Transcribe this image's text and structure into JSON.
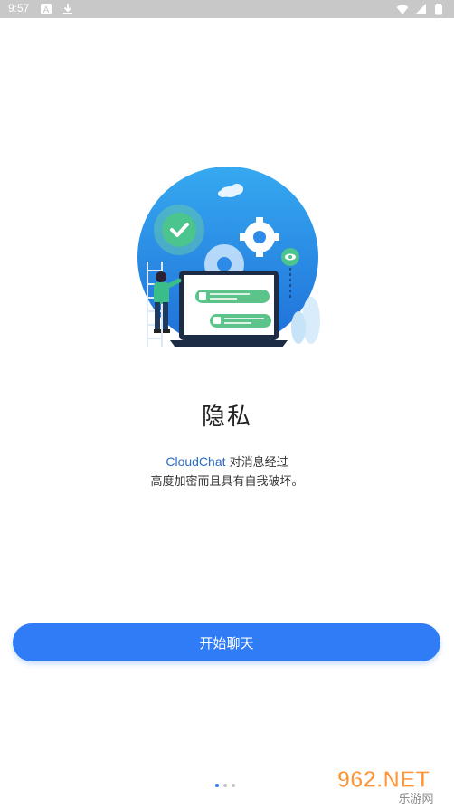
{
  "status_bar": {
    "time": "9:57",
    "icons": [
      "a-icon",
      "download-icon",
      "wifi-icon",
      "signal-icon",
      "battery-icon"
    ]
  },
  "onboarding": {
    "title": "隐私",
    "brand": "CloudChat",
    "description_line1": " 对消息经过",
    "description_line2": "高度加密而且具有自我破坏。",
    "start_button_label": "开始聊天",
    "page_indicator": {
      "total": 3,
      "active": 1
    }
  },
  "watermark": {
    "text_main": "962.NET",
    "text_sub": "乐游网"
  },
  "colors": {
    "primary": "#2f7cf6",
    "illustration_blue": "#2f8be8",
    "chat_green": "#5cc48a"
  }
}
